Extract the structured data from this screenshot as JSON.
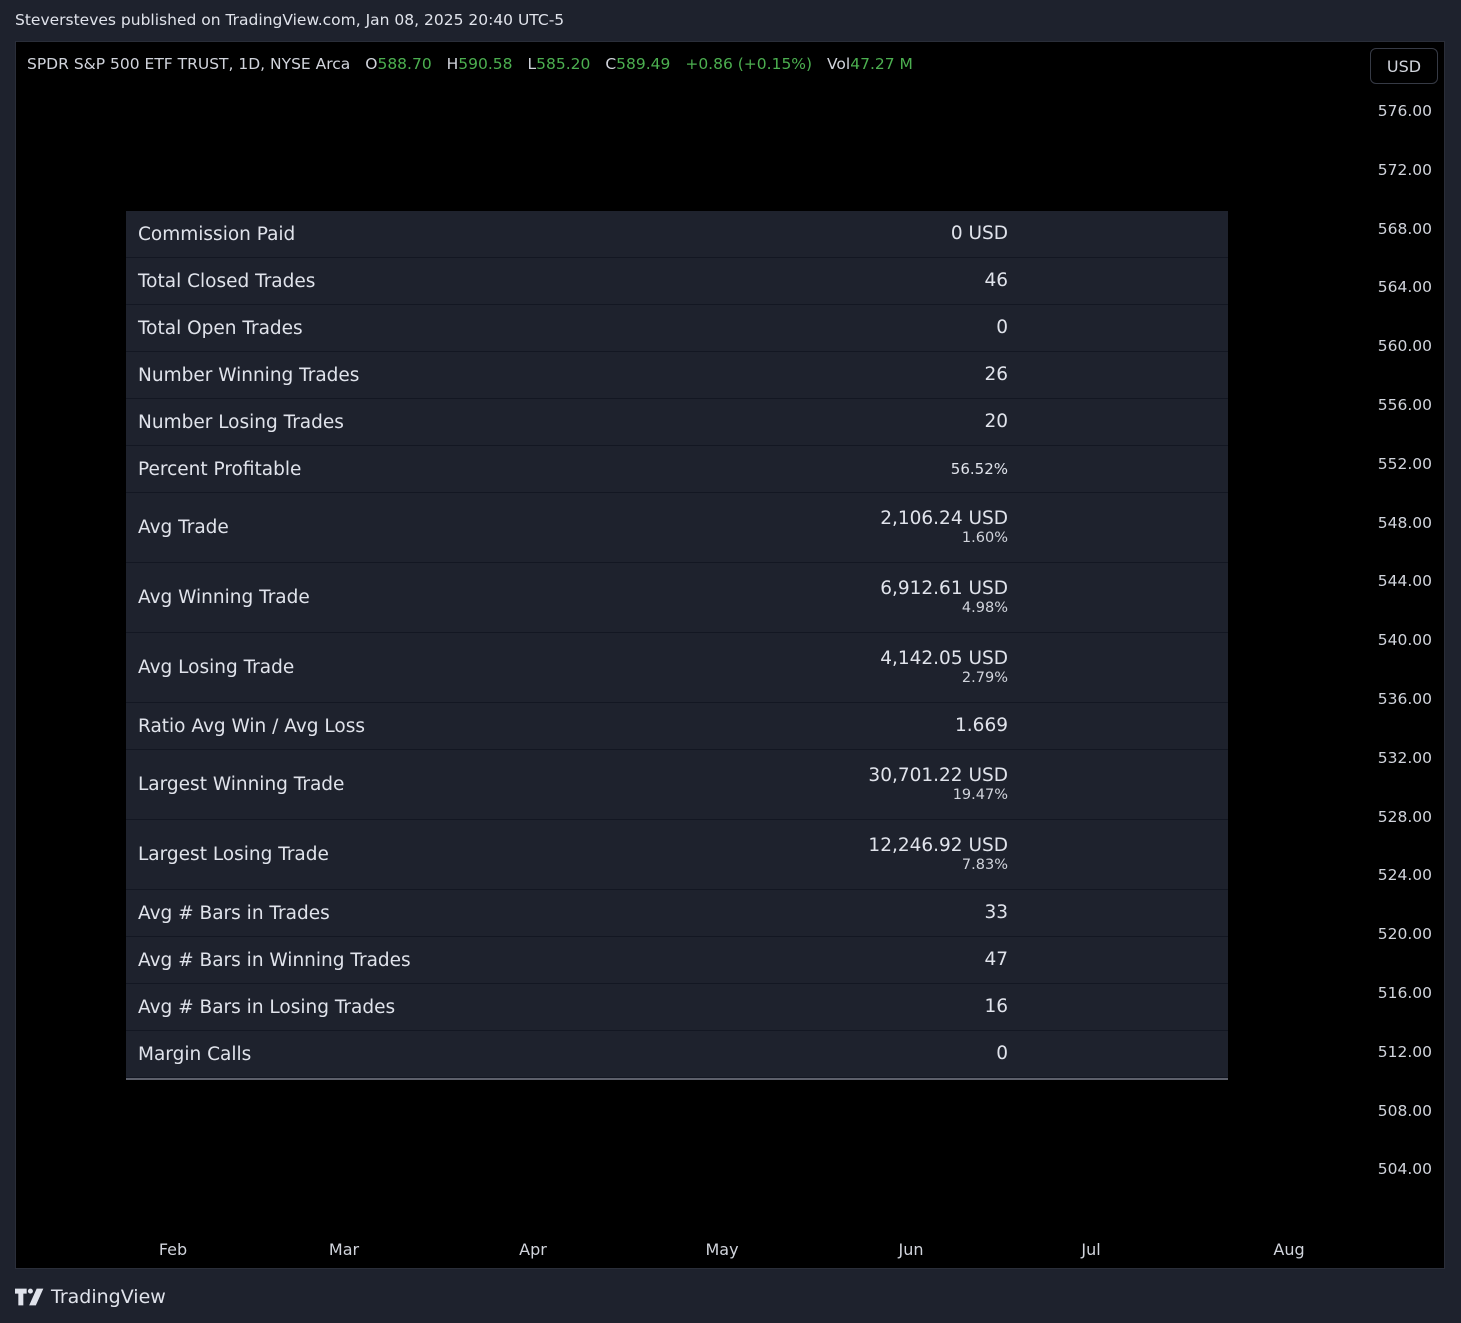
{
  "publish": {
    "text": "Steversteves published on TradingView.com, Jan 08, 2025 20:40 UTC-5"
  },
  "legend": {
    "symbol": "SPDR S&P 500 ETF TRUST, 1D, NYSE Arca",
    "o_label": "O",
    "o": "588.70",
    "h_label": "H",
    "h": "590.58",
    "l_label": "L",
    "l": "585.20",
    "c_label": "C",
    "c": "589.49",
    "change": "+0.86 (+0.15%)",
    "vol_label": "Vol",
    "vol": "47.27 M",
    "up_color": "#4caf50"
  },
  "currency": "USD",
  "y_axis": [
    "576.00",
    "572.00",
    "568.00",
    "564.00",
    "560.00",
    "556.00",
    "552.00",
    "548.00",
    "544.00",
    "540.00",
    "536.00",
    "532.00",
    "528.00",
    "524.00",
    "520.00",
    "516.00",
    "512.00",
    "508.00",
    "504.00"
  ],
  "x_axis": [
    "Feb",
    "Mar",
    "Apr",
    "May",
    "Jun",
    "Jul",
    "Aug"
  ],
  "stats": [
    {
      "label": "Commission Paid",
      "value": "0 USD"
    },
    {
      "label": "Total Closed Trades",
      "value": "46"
    },
    {
      "label": "Total Open Trades",
      "value": "0"
    },
    {
      "label": "Number Winning Trades",
      "value": "26"
    },
    {
      "label": "Number Losing Trades",
      "value": "20"
    },
    {
      "label": "Percent Profitable",
      "value": "56.52%",
      "small": true
    },
    {
      "label": "Avg Trade",
      "value": "2,106.24 USD",
      "sub": "1.60%"
    },
    {
      "label": "Avg Winning Trade",
      "value": "6,912.61 USD",
      "sub": "4.98%"
    },
    {
      "label": "Avg Losing Trade",
      "value": "4,142.05 USD",
      "sub": "2.79%"
    },
    {
      "label": "Ratio Avg Win / Avg Loss",
      "value": "1.669"
    },
    {
      "label": "Largest Winning Trade",
      "value": "30,701.22 USD",
      "sub": "19.47%"
    },
    {
      "label": "Largest Losing Trade",
      "value": "12,246.92 USD",
      "sub": "7.83%"
    },
    {
      "label": "Avg # Bars in Trades",
      "value": "33"
    },
    {
      "label": "Avg # Bars in Winning Trades",
      "value": "47"
    },
    {
      "label": "Avg # Bars in Losing Trades",
      "value": "16"
    },
    {
      "label": "Margin Calls",
      "value": "0"
    }
  ],
  "footer": {
    "brand": "TradingView"
  }
}
